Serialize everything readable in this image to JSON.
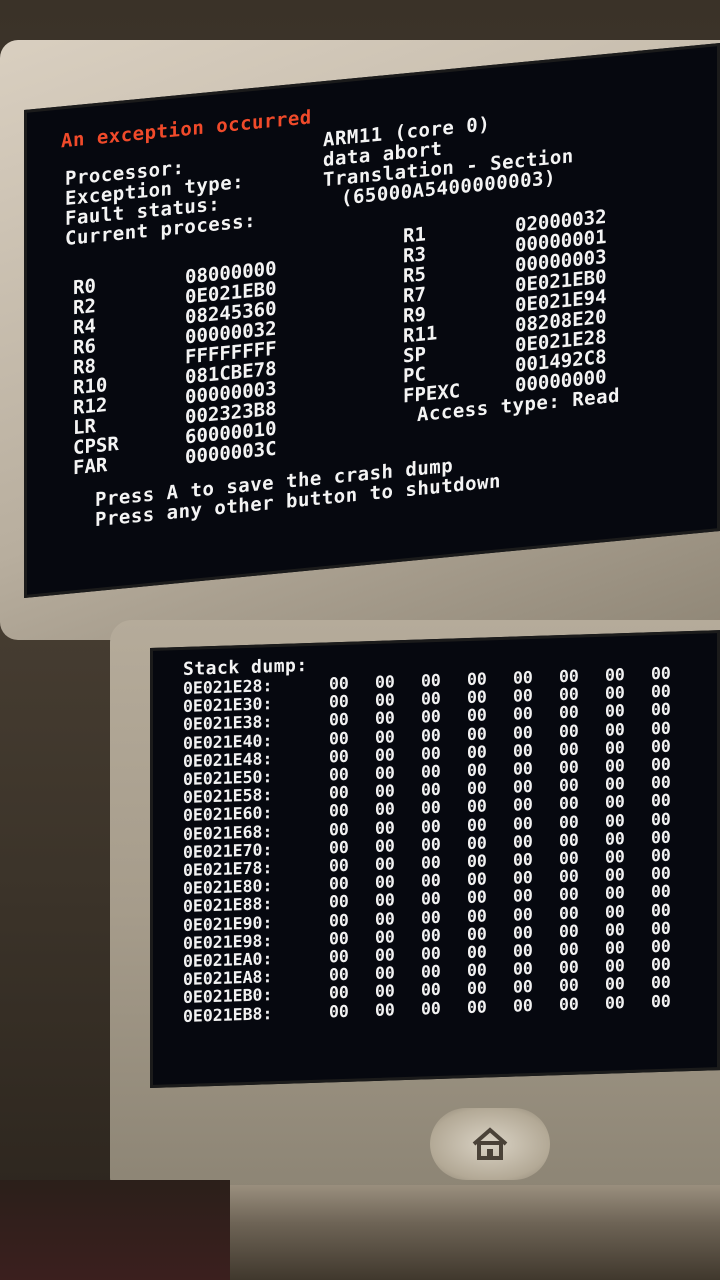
{
  "top_screen": {
    "header": "An exception occurred",
    "processor": {
      "label": "Processor:",
      "value": "ARM11 (core 0)"
    },
    "exception_type": {
      "label": "Exception type:",
      "value": "data abort"
    },
    "fault_status": {
      "label": "Fault status:",
      "value": "Translation - Section"
    },
    "current_process": {
      "label": "Current process:",
      "value": "(65000A5400000003)"
    },
    "registers_left": [
      {
        "name": "R0",
        "value": "08000000"
      },
      {
        "name": "R2",
        "value": "0E021EB0"
      },
      {
        "name": "R4",
        "value": "08245360"
      },
      {
        "name": "R6",
        "value": "00000032"
      },
      {
        "name": "R8",
        "value": "FFFFFFFF"
      },
      {
        "name": "R10",
        "value": "081CBE78"
      },
      {
        "name": "R12",
        "value": "00000003"
      },
      {
        "name": "LR",
        "value": "002323B8"
      },
      {
        "name": "CPSR",
        "value": "60000010"
      },
      {
        "name": "FAR",
        "value": "0000003C"
      }
    ],
    "registers_right": [
      {
        "name": "R1",
        "value": "02000032"
      },
      {
        "name": "R3",
        "value": "00000001"
      },
      {
        "name": "R5",
        "value": "00000003"
      },
      {
        "name": "R7",
        "value": "0E021EB0"
      },
      {
        "name": "R9",
        "value": "0E021E94"
      },
      {
        "name": "R11",
        "value": "08208E20"
      },
      {
        "name": "SP",
        "value": "0E021E28"
      },
      {
        "name": "PC",
        "value": "001492C8"
      },
      {
        "name": "FPEXC",
        "value": "00000000"
      }
    ],
    "access_type": "Access type: Read",
    "prompt_save": "Press A to save the crash dump",
    "prompt_shutdown": "Press any other button to shutdown"
  },
  "bottom_screen": {
    "title": "Stack dump:",
    "rows": [
      {
        "addr": "0E021E28:",
        "bytes": [
          "00",
          "00",
          "00",
          "00",
          "00",
          "00",
          "00",
          "00"
        ]
      },
      {
        "addr": "0E021E30:",
        "bytes": [
          "00",
          "00",
          "00",
          "00",
          "00",
          "00",
          "00",
          "00"
        ]
      },
      {
        "addr": "0E021E38:",
        "bytes": [
          "00",
          "00",
          "00",
          "00",
          "00",
          "00",
          "00",
          "00"
        ]
      },
      {
        "addr": "0E021E40:",
        "bytes": [
          "00",
          "00",
          "00",
          "00",
          "00",
          "00",
          "00",
          "00"
        ]
      },
      {
        "addr": "0E021E48:",
        "bytes": [
          "00",
          "00",
          "00",
          "00",
          "00",
          "00",
          "00",
          "00"
        ]
      },
      {
        "addr": "0E021E50:",
        "bytes": [
          "00",
          "00",
          "00",
          "00",
          "00",
          "00",
          "00",
          "00"
        ]
      },
      {
        "addr": "0E021E58:",
        "bytes": [
          "00",
          "00",
          "00",
          "00",
          "00",
          "00",
          "00",
          "00"
        ]
      },
      {
        "addr": "0E021E60:",
        "bytes": [
          "00",
          "00",
          "00",
          "00",
          "00",
          "00",
          "00",
          "00"
        ]
      },
      {
        "addr": "0E021E68:",
        "bytes": [
          "00",
          "00",
          "00",
          "00",
          "00",
          "00",
          "00",
          "00"
        ]
      },
      {
        "addr": "0E021E70:",
        "bytes": [
          "00",
          "00",
          "00",
          "00",
          "00",
          "00",
          "00",
          "00"
        ]
      },
      {
        "addr": "0E021E78:",
        "bytes": [
          "00",
          "00",
          "00",
          "00",
          "00",
          "00",
          "00",
          "00"
        ]
      },
      {
        "addr": "0E021E80:",
        "bytes": [
          "00",
          "00",
          "00",
          "00",
          "00",
          "00",
          "00",
          "00"
        ]
      },
      {
        "addr": "0E021E88:",
        "bytes": [
          "00",
          "00",
          "00",
          "00",
          "00",
          "00",
          "00",
          "00"
        ]
      },
      {
        "addr": "0E021E90:",
        "bytes": [
          "00",
          "00",
          "00",
          "00",
          "00",
          "00",
          "00",
          "00"
        ]
      },
      {
        "addr": "0E021E98:",
        "bytes": [
          "00",
          "00",
          "00",
          "00",
          "00",
          "00",
          "00",
          "00"
        ]
      },
      {
        "addr": "0E021EA0:",
        "bytes": [
          "00",
          "00",
          "00",
          "00",
          "00",
          "00",
          "00",
          "00"
        ]
      },
      {
        "addr": "0E021EA8:",
        "bytes": [
          "00",
          "00",
          "00",
          "00",
          "00",
          "00",
          "00",
          "00"
        ]
      },
      {
        "addr": "0E021EB0:",
        "bytes": [
          "00",
          "00",
          "00",
          "00",
          "00",
          "00",
          "00",
          "00"
        ]
      },
      {
        "addr": "0E021EB8:",
        "bytes": [
          "00",
          "00",
          "00",
          "00",
          "00",
          "00",
          "00",
          "00"
        ]
      }
    ]
  },
  "device": {
    "home_icon": "home-icon"
  },
  "colors": {
    "header": "#f04a2a",
    "text": "#f4f4f4",
    "screen_bg": "#06080f"
  }
}
